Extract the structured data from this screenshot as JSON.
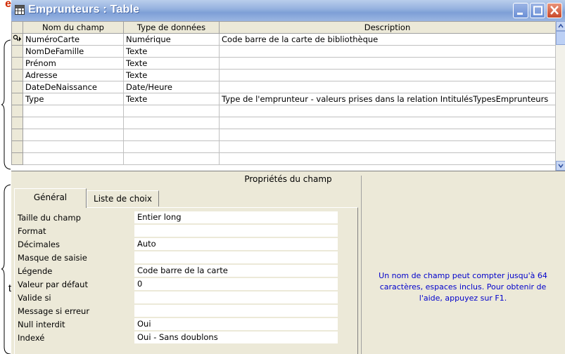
{
  "annotations": {
    "top_marker": "e",
    "side_marker": "t"
  },
  "window": {
    "title": "Emprunteurs : Table"
  },
  "grid": {
    "columns": [
      "Nom du champ",
      "Type de données",
      "Description"
    ],
    "rows": [
      {
        "name": "NuméroCarte",
        "type": "Numérique",
        "description": "Code barre de la carte de bibliothèque",
        "primary_key": true
      },
      {
        "name": "NomDeFamille",
        "type": "Texte",
        "description": ""
      },
      {
        "name": "Prénom",
        "type": "Texte",
        "description": ""
      },
      {
        "name": "Adresse",
        "type": "Texte",
        "description": ""
      },
      {
        "name": "DateDeNaissance",
        "type": "Date/Heure",
        "description": ""
      },
      {
        "name": "Type",
        "type": "Texte",
        "description": "Type de l'emprunteur - valeurs prises dans la relation IntitulésTypesEmprunteurs"
      },
      {
        "name": "",
        "type": "",
        "description": ""
      },
      {
        "name": "",
        "type": "",
        "description": ""
      },
      {
        "name": "",
        "type": "",
        "description": ""
      },
      {
        "name": "",
        "type": "",
        "description": ""
      },
      {
        "name": "",
        "type": "",
        "description": ""
      }
    ]
  },
  "properties": {
    "header": "Propriétés du champ",
    "tabs": [
      "Général",
      "Liste de choix"
    ],
    "rows": [
      {
        "label": "Taille du champ",
        "value": "Entier long"
      },
      {
        "label": "Format",
        "value": ""
      },
      {
        "label": "Décimales",
        "value": "Auto"
      },
      {
        "label": "Masque de saisie",
        "value": ""
      },
      {
        "label": "Légende",
        "value": "Code barre de la carte"
      },
      {
        "label": "Valeur par défaut",
        "value": "0"
      },
      {
        "label": "Valide si",
        "value": ""
      },
      {
        "label": "Message si erreur",
        "value": ""
      },
      {
        "label": "Null interdit",
        "value": "Oui"
      },
      {
        "label": "Indexé",
        "value": "Oui - Sans doublons"
      }
    ],
    "help": "Un nom de champ peut compter jusqu'à 64 caractères, espaces inclus. Pour obtenir de l'aide, appuyez sur F1."
  }
}
